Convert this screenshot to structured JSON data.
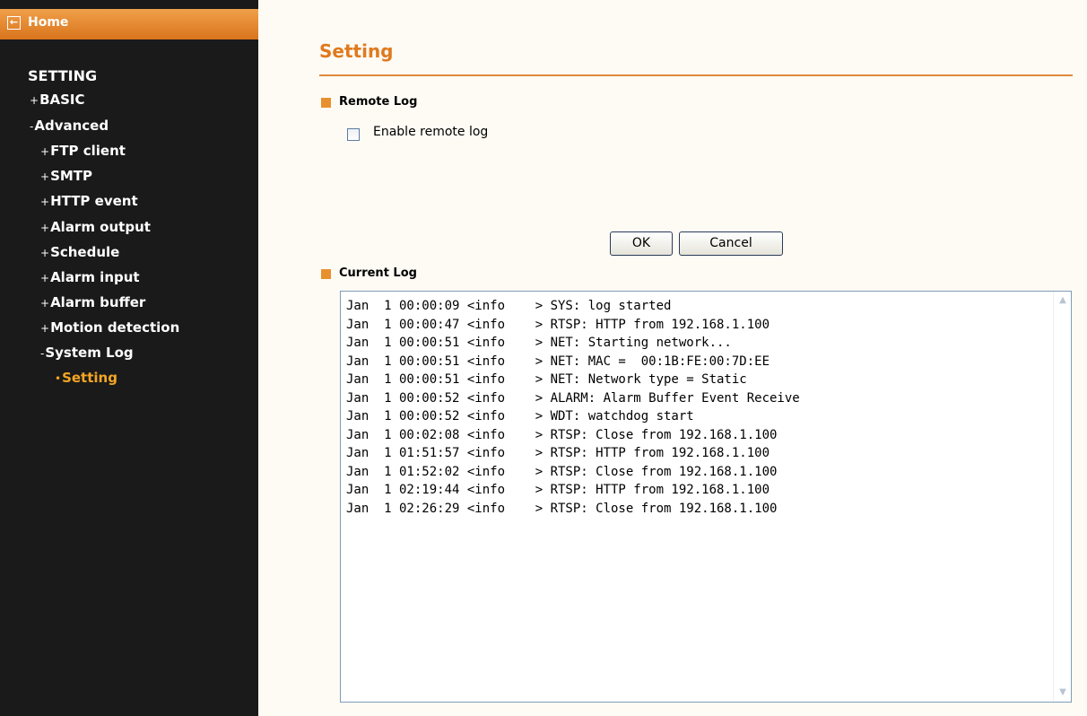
{
  "sidebar": {
    "home_label": "Home",
    "section_title": "SETTING",
    "items": [
      {
        "prefix": "+",
        "label": "BASIC"
      },
      {
        "prefix": "-",
        "label": "Advanced"
      },
      {
        "prefix": "+",
        "label": "FTP client"
      },
      {
        "prefix": "+",
        "label": "SMTP"
      },
      {
        "prefix": "+",
        "label": "HTTP event"
      },
      {
        "prefix": "+",
        "label": "Alarm output"
      },
      {
        "prefix": "+",
        "label": "Schedule"
      },
      {
        "prefix": "+",
        "label": "Alarm input"
      },
      {
        "prefix": "+",
        "label": "Alarm buffer"
      },
      {
        "prefix": "+",
        "label": "Motion detection"
      },
      {
        "prefix": "-",
        "label": "System Log"
      },
      {
        "prefix": "•",
        "label": "Setting"
      }
    ]
  },
  "main": {
    "title": "Setting",
    "remote_log": {
      "heading": "Remote Log",
      "checkbox_label": "Enable remote log",
      "checked": false
    },
    "buttons": {
      "ok": "OK",
      "cancel": "Cancel"
    },
    "current_log": {
      "heading": "Current Log",
      "lines": [
        "Jan  1 00:00:09 <info    > SYS: log started",
        "Jan  1 00:00:47 <info    > RTSP: HTTP from 192.168.1.100",
        "Jan  1 00:00:51 <info    > NET: Starting network...",
        "Jan  1 00:00:51 <info    > NET: MAC =  00:1B:FE:00:7D:EE",
        "Jan  1 00:00:51 <info    > NET: Network type = Static",
        "Jan  1 00:00:52 <info    > ALARM: Alarm Buffer Event Receive",
        "Jan  1 00:00:52 <info    > WDT: watchdog start",
        "Jan  1 00:02:08 <info    > RTSP: Close from 192.168.1.100",
        "Jan  1 01:51:57 <info    > RTSP: HTTP from 192.168.1.100",
        "Jan  1 01:52:02 <info    > RTSP: Close from 192.168.1.100",
        "Jan  1 02:19:44 <info    > RTSP: HTTP from 192.168.1.100",
        "Jan  1 02:26:29 <info    > RTSP: Close from 192.168.1.100"
      ]
    }
  },
  "colors": {
    "sidebar_bg": "#1a1a1a",
    "accent_orange": "#e07a1e",
    "active_nav": "#f5a623",
    "page_bg": "#fdfbf4"
  },
  "icons": {
    "home": "back-arrow-box-icon"
  }
}
